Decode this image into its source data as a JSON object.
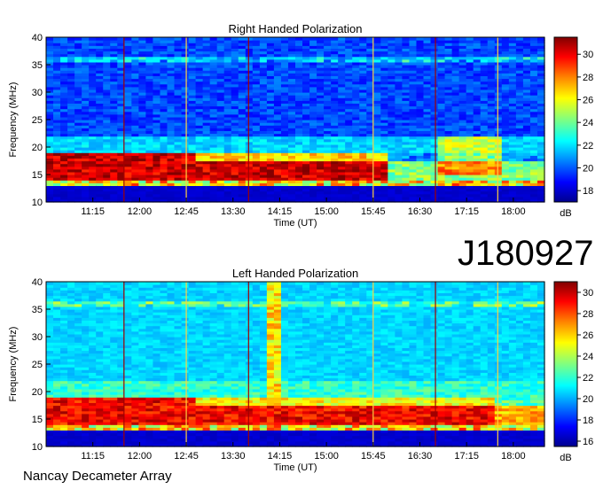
{
  "observation_id": "J180927",
  "footer_text": "Nancay Decameter Array",
  "chart_data": [
    {
      "type": "heatmap",
      "title": "Right Handed Polarization",
      "xlabel": "Time (UT)",
      "ylabel": "Frequency (MHz)",
      "x_ticks": [
        "11:15",
        "12:00",
        "12:45",
        "13:30",
        "14:15",
        "15:00",
        "15:45",
        "16:30",
        "17:15",
        "18:00"
      ],
      "y_ticks": [
        10,
        15,
        20,
        25,
        30,
        35,
        40
      ],
      "ylim": [
        10,
        40
      ],
      "colorbar_label": "dB",
      "colorbar_ticks": [
        18,
        20,
        22,
        24,
        26,
        28,
        30
      ],
      "colorbar_range": [
        17,
        31.5
      ],
      "colormap": [
        "#00008f",
        "#0000ff",
        "#00a0ff",
        "#00ffff",
        "#80ff80",
        "#ffff00",
        "#ff8000",
        "#ff0000",
        "#800000"
      ],
      "markers_ut": [
        "11:45",
        "12:45",
        "13:45",
        "15:45",
        "16:45",
        "17:45"
      ]
    },
    {
      "type": "heatmap",
      "title": "Left Handed Polarization",
      "xlabel": "Time (UT)",
      "ylabel": "Frequency (MHz)",
      "x_ticks": [
        "11:15",
        "12:00",
        "12:45",
        "13:30",
        "14:15",
        "15:00",
        "15:45",
        "16:30",
        "17:15",
        "18:00"
      ],
      "y_ticks": [
        10,
        15,
        20,
        25,
        30,
        35,
        40
      ],
      "ylim": [
        10,
        40
      ],
      "colorbar_label": "dB",
      "colorbar_ticks": [
        16,
        18,
        20,
        22,
        24,
        26,
        28,
        30
      ],
      "colorbar_range": [
        15.5,
        31
      ],
      "colormap": [
        "#00008f",
        "#0000ff",
        "#00a0ff",
        "#00ffff",
        "#80ff80",
        "#ffff00",
        "#ff8000",
        "#ff0000",
        "#800000"
      ],
      "markers_ut": [
        "11:45",
        "12:45",
        "13:45",
        "15:45",
        "16:45",
        "17:45"
      ]
    }
  ]
}
